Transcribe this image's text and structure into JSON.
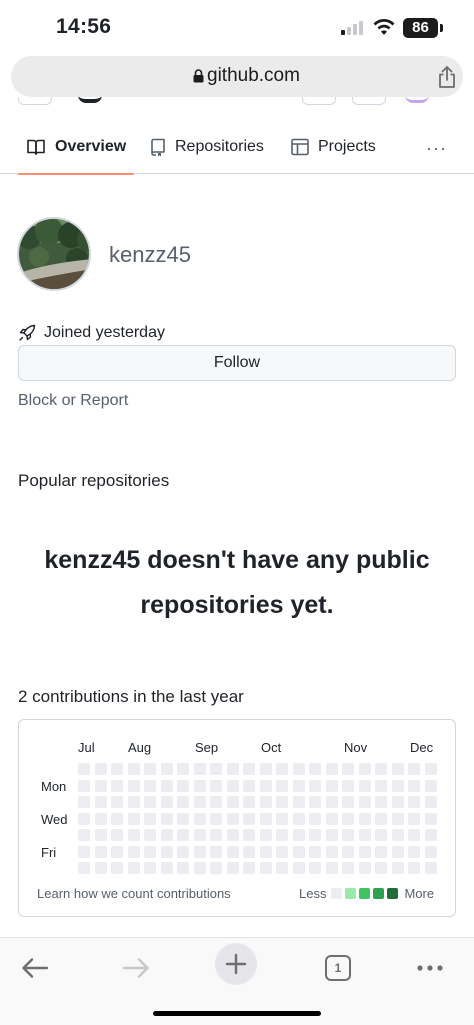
{
  "status_bar": {
    "time": "14:56",
    "battery": "86"
  },
  "browser": {
    "url": "github.com",
    "tab_count": "1"
  },
  "nav_tabs": [
    {
      "label": "Overview",
      "active": true
    },
    {
      "label": "Repositories",
      "active": false
    },
    {
      "label": "Projects",
      "active": false
    }
  ],
  "nav_more": "···",
  "profile": {
    "username": "kenzz45",
    "joined": "Joined yesterday",
    "follow_label": "Follow",
    "block_report": "Block or Report"
  },
  "popular": {
    "heading": "Popular repositories",
    "empty_message": "kenzz45 doesn't have any public repositories yet."
  },
  "contributions": {
    "heading": "2 contributions in the last year",
    "months": [
      "Jul",
      "Aug",
      "Sep",
      "Oct",
      "Nov",
      "Dec"
    ],
    "days": [
      "Mon",
      "Wed",
      "Fri"
    ],
    "weeks": 22,
    "learn_link": "Learn how we count contributions",
    "legend_less": "Less",
    "legend_more": "More",
    "legend_colors": [
      "#ebedf0",
      "#9be9a8",
      "#40c463",
      "#30a14e",
      "#216e39"
    ]
  },
  "icons": {
    "back": "arrow-left-icon",
    "forward": "arrow-right-icon",
    "new_tab": "plus-icon",
    "tabs": "tabs-icon",
    "more": "ellipsis-icon"
  }
}
